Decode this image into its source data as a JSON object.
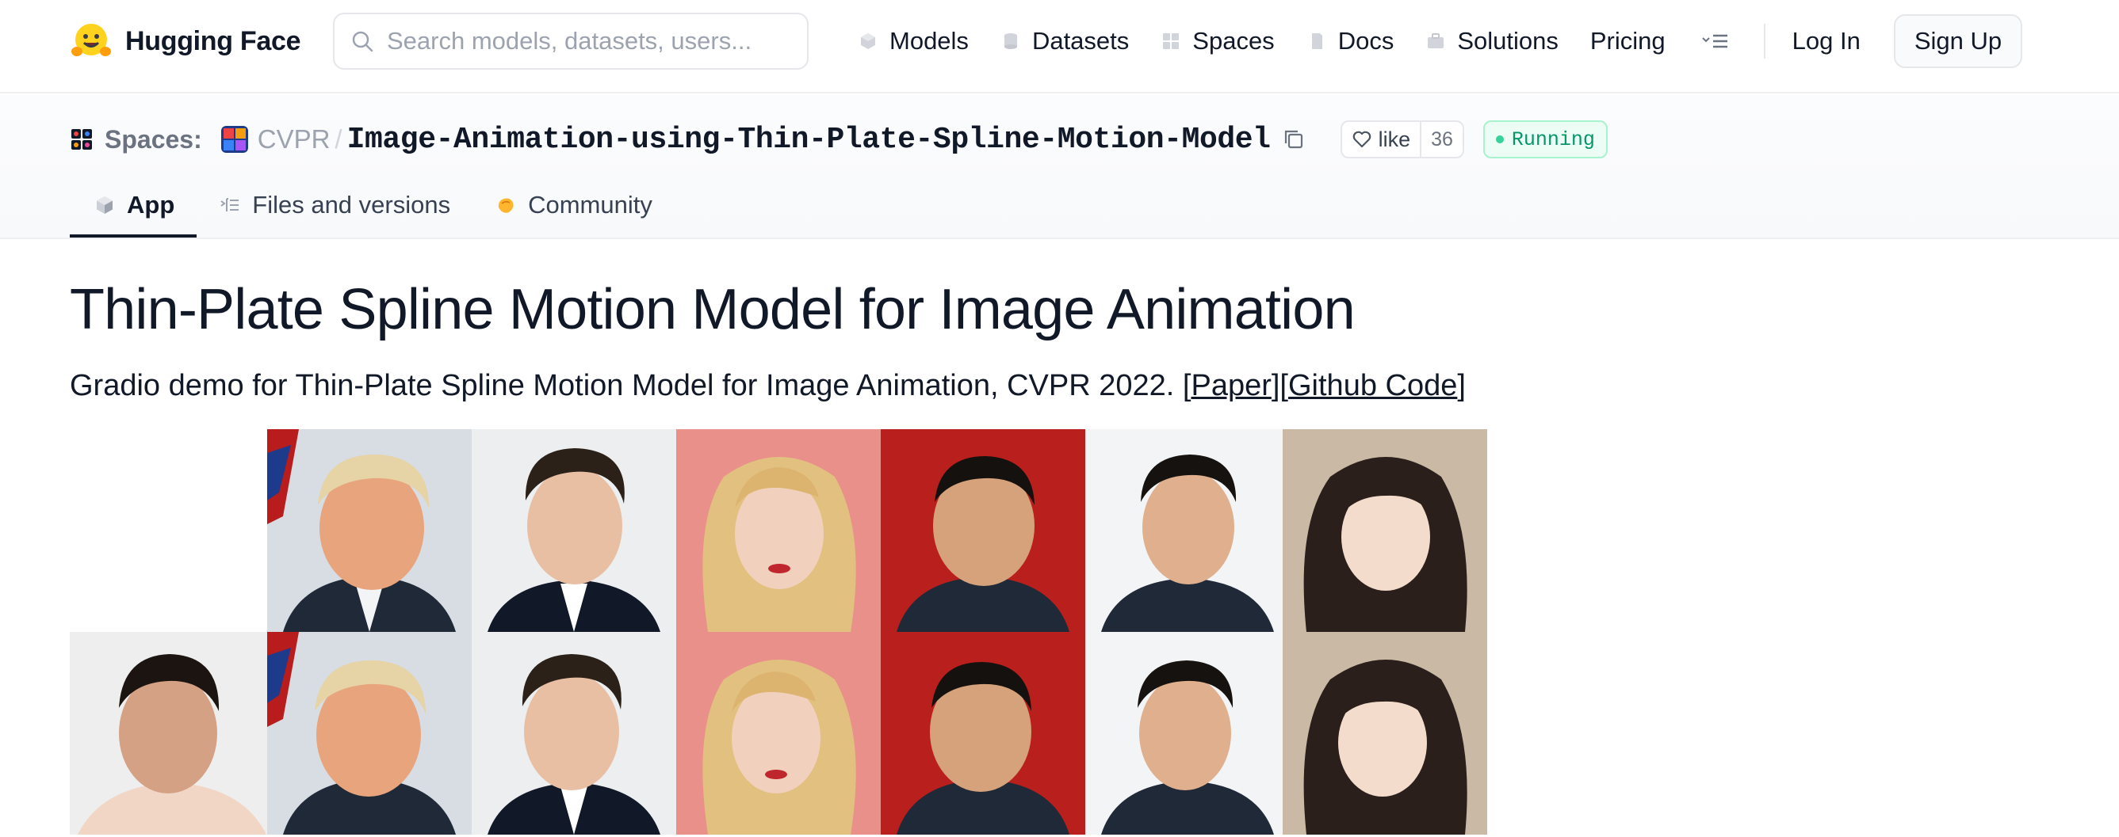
{
  "nav": {
    "brand": "Hugging Face",
    "search_placeholder": "Search models, datasets, users...",
    "links": [
      "Models",
      "Datasets",
      "Spaces",
      "Docs",
      "Solutions"
    ],
    "pricing": "Pricing",
    "login": "Log In",
    "signup": "Sign Up"
  },
  "space": {
    "section_label": "Spaces:",
    "org": "CVPR",
    "separator": "/",
    "repo": "Image-Animation-using-Thin-Plate-Spline-Motion-Model",
    "like_label": "like",
    "like_count": "36",
    "status": "Running",
    "tabs": [
      "App",
      "Files and versions",
      "Community"
    ]
  },
  "app": {
    "title": "Thin-Plate Spline Motion Model for Image Animation",
    "description": "Gradio demo for Thin-Plate Spline Motion Model for Image Animation, CVPR 2022. ",
    "link_paper": "Paper",
    "link_code": "Github Code"
  },
  "colors": {
    "accent_running": "#059669",
    "text_primary": "#111827",
    "text_muted": "#6b7280"
  }
}
